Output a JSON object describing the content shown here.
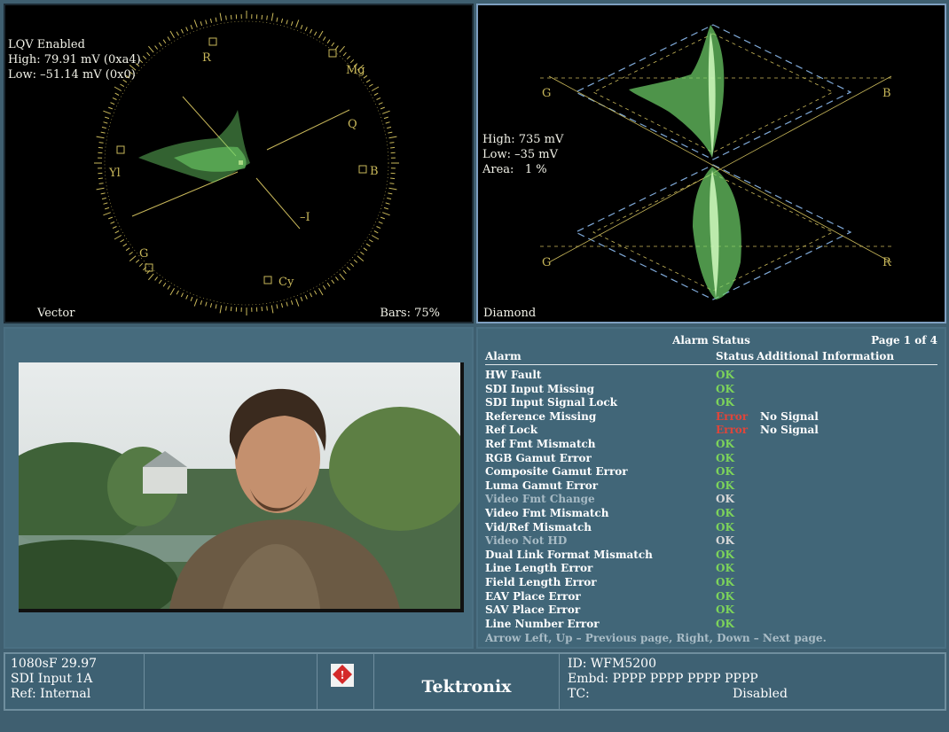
{
  "vector": {
    "readout": [
      "LQV Enabled",
      "High: 79.91 mV (0xa4)",
      "Low: –51.14 mV (0x0)"
    ],
    "label": "Vector",
    "bars": "Bars: 75%",
    "targets": [
      "R",
      "Mg",
      "B",
      "Cy",
      "G",
      "Yl"
    ],
    "axes": [
      "Q",
      "–I"
    ]
  },
  "diamond": {
    "readout": [
      "High: 735 mV",
      "Low: –35 mV",
      "Area:   1 %"
    ],
    "label": "Diamond",
    "corners": [
      "G",
      "B",
      "G",
      "R"
    ]
  },
  "alarm": {
    "title": "Alarm Status",
    "page": "Page 1 of 4",
    "columns": [
      "Alarm",
      "Status",
      "Additional Information"
    ],
    "rows": [
      {
        "name": "HW Fault",
        "status": "OK",
        "info": "",
        "state": "ok"
      },
      {
        "name": "SDI Input Missing",
        "status": "OK",
        "info": "",
        "state": "ok"
      },
      {
        "name": "SDI Input Signal Lock",
        "status": "OK",
        "info": "",
        "state": "ok"
      },
      {
        "name": "Reference Missing",
        "status": "Error",
        "info": "No Signal",
        "state": "err"
      },
      {
        "name": "Ref Lock",
        "status": "Error",
        "info": "No Signal",
        "state": "err"
      },
      {
        "name": "Ref Fmt Mismatch",
        "status": "OK",
        "info": "",
        "state": "ok"
      },
      {
        "name": "RGB Gamut Error",
        "status": "OK",
        "info": "",
        "state": "ok"
      },
      {
        "name": "Composite Gamut Error",
        "status": "OK",
        "info": "",
        "state": "ok"
      },
      {
        "name": "Luma Gamut Error",
        "status": "OK",
        "info": "",
        "state": "ok"
      },
      {
        "name": "Video Fmt Change",
        "status": "OK",
        "info": "",
        "state": "dim"
      },
      {
        "name": "Video Fmt Mismatch",
        "status": "OK",
        "info": "",
        "state": "ok"
      },
      {
        "name": "Vid/Ref Mismatch",
        "status": "OK",
        "info": "",
        "state": "ok"
      },
      {
        "name": "Video Not HD",
        "status": "OK",
        "info": "",
        "state": "dim"
      },
      {
        "name": "Dual Link Format Mismatch",
        "status": "OK",
        "info": "",
        "state": "ok"
      },
      {
        "name": "Line Length Error",
        "status": "OK",
        "info": "",
        "state": "ok"
      },
      {
        "name": "Field Length Error",
        "status": "OK",
        "info": "",
        "state": "ok"
      },
      {
        "name": "EAV Place Error",
        "status": "OK",
        "info": "",
        "state": "ok"
      },
      {
        "name": "SAV Place Error",
        "status": "OK",
        "info": "",
        "state": "ok"
      },
      {
        "name": "Line Number Error",
        "status": "OK",
        "info": "",
        "state": "ok"
      }
    ],
    "hint": "Arrow Left, Up – Previous page, Right, Down – Next page."
  },
  "status": {
    "format": "1080sF 29.97",
    "input": "SDI Input 1A",
    "ref": "Ref: Internal",
    "brand": "Tektronix",
    "id": "ID: WFM5200",
    "embd": "Embd: PPPP PPPP PPPP PPPP",
    "tc_label": "TC:",
    "tc_value": "Disabled"
  },
  "colors": {
    "trace": "#6fd36a",
    "graticule": "#c9b85a",
    "ok": "#7dd45a",
    "error": "#e0453a",
    "diamond_dash": "#7fa9d8"
  }
}
